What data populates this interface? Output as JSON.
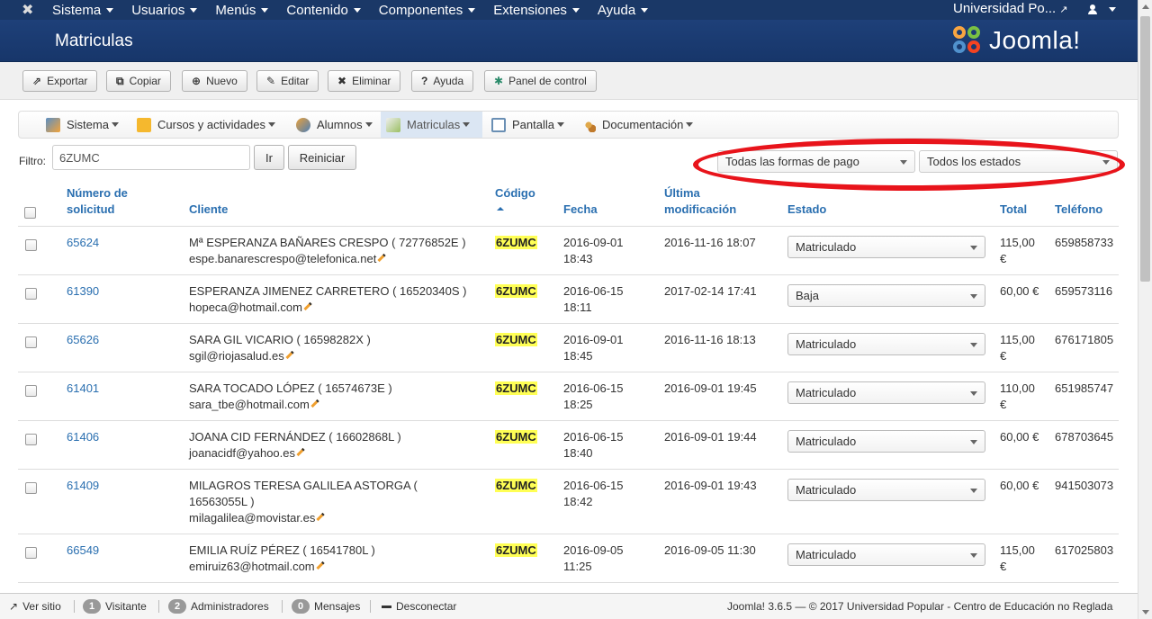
{
  "topbar": {
    "menus": [
      "Sistema",
      "Usuarios",
      "Menús",
      "Contenido",
      "Componentes",
      "Extensiones",
      "Ayuda"
    ],
    "site_name": "Universidad Po..."
  },
  "header": {
    "title": "Matriculas",
    "logo_text": "Joomla!"
  },
  "toolbar": {
    "exportar": "Exportar",
    "copiar": "Copiar",
    "nuevo": "Nuevo",
    "editar": "Editar",
    "eliminar": "Eliminar",
    "ayuda": "Ayuda",
    "panel": "Panel de control"
  },
  "submenu": {
    "sistema": "Sistema",
    "cursos": "Cursos y actividades",
    "alumnos": "Alumnos",
    "matriculas": "Matriculas",
    "pantalla": "Pantalla",
    "documentacion": "Documentación"
  },
  "filter": {
    "label": "Filtro:",
    "value": "6ZUMC",
    "go": "Ir",
    "reset": "Reiniciar",
    "payment_select": "Todas las formas de pago",
    "status_select": "Todos los estados"
  },
  "table": {
    "headers": {
      "numero_l1": "Número de",
      "numero_l2": "solicitud",
      "cliente": "Cliente",
      "codigo": "Código",
      "fecha": "Fecha",
      "ultima_l1": "Última",
      "ultima_l2": "modificación",
      "estado": "Estado",
      "total": "Total",
      "telefono": "Teléfono"
    },
    "rows": [
      {
        "numero": "65624",
        "cliente_l1": "Mª ESPERANZA BAÑARES CRESPO ( 72776852E )",
        "cliente_l2": "",
        "email": "espe.banarescrespo@telefonica.net",
        "codigo": "6ZUMC",
        "fecha_l1": "2016-09-01",
        "fecha_l2": "18:43",
        "modificacion": "2016-11-16 18:07",
        "estado": "Matriculado",
        "total_l1": "115,00",
        "total_l2": "€",
        "telefono": "659858733"
      },
      {
        "numero": "61390",
        "cliente_l1": "ESPERANZA JIMENEZ CARRETERO ( 16520340S )",
        "cliente_l2": "",
        "email": "hopeca@hotmail.com",
        "codigo": "6ZUMC",
        "fecha_l1": "2016-06-15",
        "fecha_l2": "18:11",
        "modificacion": "2017-02-14 17:41",
        "estado": "Baja",
        "total_l1": "60,00 €",
        "total_l2": "",
        "telefono": "659573116"
      },
      {
        "numero": "65626",
        "cliente_l1": "SARA GIL VICARIO ( 16598282X )",
        "cliente_l2": "",
        "email": "sgil@riojasalud.es",
        "codigo": "6ZUMC",
        "fecha_l1": "2016-09-01",
        "fecha_l2": "18:45",
        "modificacion": "2016-11-16 18:13",
        "estado": "Matriculado",
        "total_l1": "115,00",
        "total_l2": "€",
        "telefono": "676171805"
      },
      {
        "numero": "61401",
        "cliente_l1": "SARA TOCADO LÓPEZ ( 16574673E )",
        "cliente_l2": "",
        "email": "sara_tbe@hotmail.com",
        "codigo": "6ZUMC",
        "fecha_l1": "2016-06-15",
        "fecha_l2": "18:25",
        "modificacion": "2016-09-01 19:45",
        "estado": "Matriculado",
        "total_l1": "110,00",
        "total_l2": "€",
        "telefono": "651985747"
      },
      {
        "numero": "61406",
        "cliente_l1": "JOANA CID FERNÁNDEZ ( 16602868L )",
        "cliente_l2": "",
        "email": "joanacidf@yahoo.es",
        "codigo": "6ZUMC",
        "fecha_l1": "2016-06-15",
        "fecha_l2": "18:40",
        "modificacion": "2016-09-01 19:44",
        "estado": "Matriculado",
        "total_l1": "60,00 €",
        "total_l2": "",
        "telefono": "678703645"
      },
      {
        "numero": "61409",
        "cliente_l1": "MILAGROS TERESA GALILEA ASTORGA (",
        "cliente_l2": "16563055L )",
        "email": "milagalilea@movistar.es",
        "codigo": "6ZUMC",
        "fecha_l1": "2016-06-15",
        "fecha_l2": "18:42",
        "modificacion": "2016-09-01 19:43",
        "estado": "Matriculado",
        "total_l1": "60,00 €",
        "total_l2": "",
        "telefono": "941503073"
      },
      {
        "numero": "66549",
        "cliente_l1": "EMILIA RUÍZ PÉREZ ( 16541780L )",
        "cliente_l2": "",
        "email": "emiruiz63@hotmail.com",
        "codigo": "6ZUMC",
        "fecha_l1": "2016-09-05",
        "fecha_l2": "11:25",
        "modificacion": "2016-09-05 11:30",
        "estado": "Matriculado",
        "total_l1": "115,00",
        "total_l2": "€",
        "telefono": "617025803"
      }
    ]
  },
  "statusbar": {
    "ver_sitio": "Ver sitio",
    "visitantes_count": "1",
    "visitantes": "Visitante",
    "admins_count": "2",
    "admins": "Administradores",
    "mensajes_count": "0",
    "mensajes": "Mensajes",
    "desconectar": "Desconectar",
    "footer": "Joomla! 3.6.5 — © 2017 Universidad Popular - Centro de Educación no Reglada"
  },
  "colors": {
    "navbar": "#1a3867",
    "header": "#1c3d71",
    "link": "#2a6fb0",
    "highlight": "#ffff55",
    "annotation": "#e8141b"
  }
}
